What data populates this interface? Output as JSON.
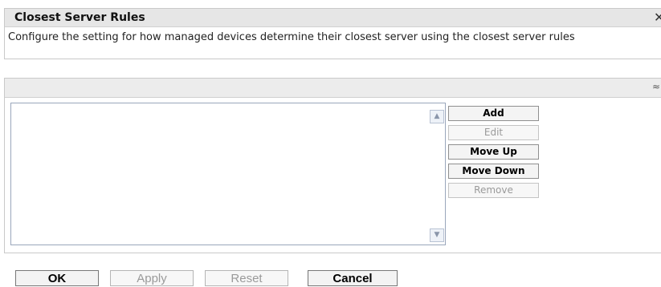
{
  "panel": {
    "title": "Closest Server Rules",
    "close_icon": "✕",
    "description": "Configure the setting for how managed devices determine their closest server using the closest server rules"
  },
  "rules_box": {
    "collapse_icon": "≈",
    "items": [],
    "scroll_up": "▲",
    "scroll_down": "▼"
  },
  "side_buttons": {
    "add": "Add",
    "edit": "Edit",
    "move_up": "Move Up",
    "move_down": "Move Down",
    "remove": "Remove"
  },
  "bottom_buttons": {
    "ok": "OK",
    "apply": "Apply",
    "reset": "Reset",
    "cancel": "Cancel"
  }
}
